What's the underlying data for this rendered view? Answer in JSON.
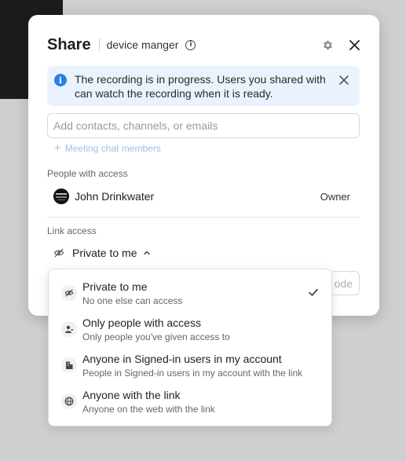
{
  "share_dialog": {
    "title": "Share",
    "subtitle": "device manger",
    "banner_text": "The recording is in progress. Users you shared with can watch the recording when it is ready.",
    "contacts_placeholder": "Add contacts, channels, or emails",
    "meeting_chat_label": "Meeting chat members",
    "people_section_label": "People with access",
    "person": {
      "name": "John Drinkwater",
      "role": "Owner"
    },
    "link_section_label": "Link access",
    "link_selected": "Private to me",
    "partial_button_text": "ode"
  },
  "link_menu": {
    "options": [
      {
        "title": "Private to me",
        "desc": "No one else can access",
        "icon": "eye-slash-icon",
        "selected": true
      },
      {
        "title": "Only people with access",
        "desc": "Only people you've given access to",
        "icon": "person-icon",
        "selected": false
      },
      {
        "title": "Anyone in Signed-in users in my account",
        "desc": "People in Signed-in users in my account with the link",
        "icon": "building-icon",
        "selected": false
      },
      {
        "title": "Anyone with the link",
        "desc": "Anyone on the web with the link",
        "icon": "globe-icon",
        "selected": false
      }
    ]
  },
  "colors": {
    "accent": "#2b7ee6",
    "banner_bg": "#eaf3fd",
    "link_muted": "#9cc1ee"
  }
}
